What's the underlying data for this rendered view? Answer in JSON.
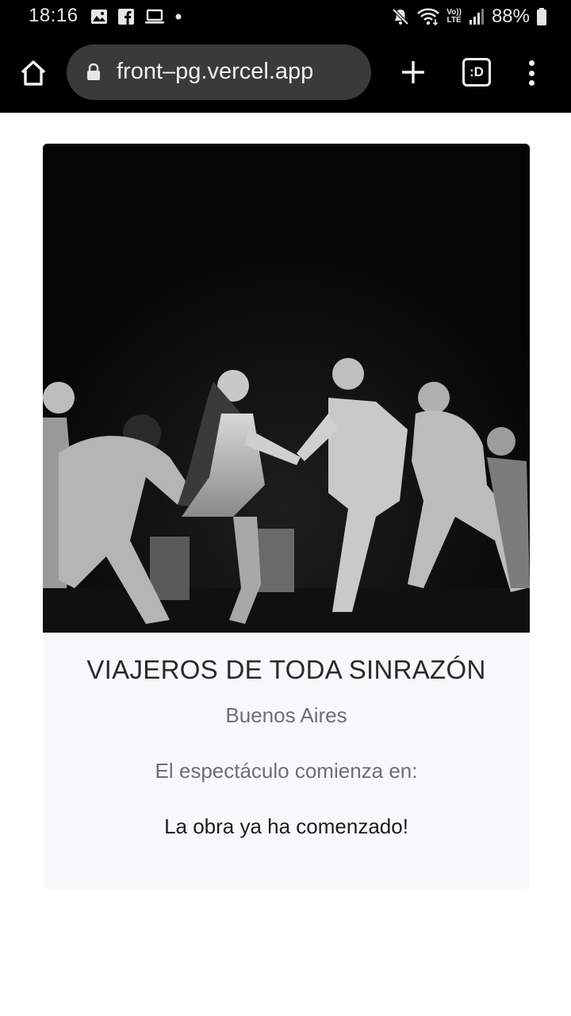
{
  "status_bar": {
    "time": "18:16",
    "battery_percent": "88%",
    "battery_level": 0.88,
    "notification_icons": [
      "image-icon",
      "facebook-icon",
      "laptop-icon",
      "dot-icon"
    ],
    "system_icons": [
      "mute-icon",
      "wifi-icon",
      "volte-icon",
      "signal-icon",
      "battery-icon"
    ],
    "volte_top": "Vo))",
    "volte_bottom": "LTE"
  },
  "browser": {
    "url": "front–pg.vercel.app",
    "tabs_label": ":D"
  },
  "card": {
    "image_alt": "Black and white photo of actors on stage pulling hands",
    "title": "VIAJEROS DE TODA SINRAZÓN",
    "city": "Buenos Aires",
    "countdown_label": "El espectáculo comienza en:",
    "status": "La obra ya ha comenzado!"
  },
  "colors": {
    "bar_background": "#000000",
    "url_pill": "#3a3a3a",
    "card_background": "#f7f8fa",
    "muted_text": "#6c6f73"
  }
}
